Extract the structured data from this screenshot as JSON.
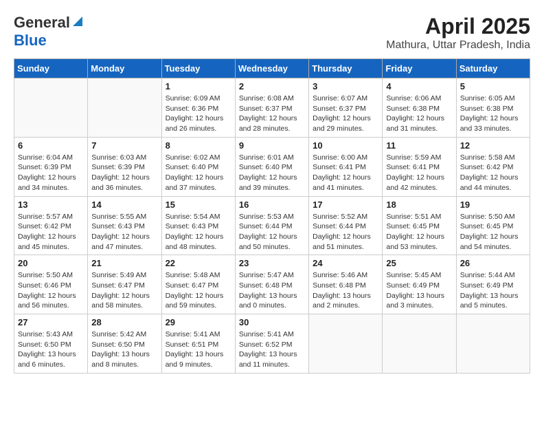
{
  "header": {
    "logo_general": "General",
    "logo_blue": "Blue",
    "month": "April 2025",
    "location": "Mathura, Uttar Pradesh, India"
  },
  "days_of_week": [
    "Sunday",
    "Monday",
    "Tuesday",
    "Wednesday",
    "Thursday",
    "Friday",
    "Saturday"
  ],
  "weeks": [
    [
      {
        "day": "",
        "info": ""
      },
      {
        "day": "",
        "info": ""
      },
      {
        "day": "1",
        "info": "Sunrise: 6:09 AM\nSunset: 6:36 PM\nDaylight: 12 hours and 26 minutes."
      },
      {
        "day": "2",
        "info": "Sunrise: 6:08 AM\nSunset: 6:37 PM\nDaylight: 12 hours and 28 minutes."
      },
      {
        "day": "3",
        "info": "Sunrise: 6:07 AM\nSunset: 6:37 PM\nDaylight: 12 hours and 29 minutes."
      },
      {
        "day": "4",
        "info": "Sunrise: 6:06 AM\nSunset: 6:38 PM\nDaylight: 12 hours and 31 minutes."
      },
      {
        "day": "5",
        "info": "Sunrise: 6:05 AM\nSunset: 6:38 PM\nDaylight: 12 hours and 33 minutes."
      }
    ],
    [
      {
        "day": "6",
        "info": "Sunrise: 6:04 AM\nSunset: 6:39 PM\nDaylight: 12 hours and 34 minutes."
      },
      {
        "day": "7",
        "info": "Sunrise: 6:03 AM\nSunset: 6:39 PM\nDaylight: 12 hours and 36 minutes."
      },
      {
        "day": "8",
        "info": "Sunrise: 6:02 AM\nSunset: 6:40 PM\nDaylight: 12 hours and 37 minutes."
      },
      {
        "day": "9",
        "info": "Sunrise: 6:01 AM\nSunset: 6:40 PM\nDaylight: 12 hours and 39 minutes."
      },
      {
        "day": "10",
        "info": "Sunrise: 6:00 AM\nSunset: 6:41 PM\nDaylight: 12 hours and 41 minutes."
      },
      {
        "day": "11",
        "info": "Sunrise: 5:59 AM\nSunset: 6:41 PM\nDaylight: 12 hours and 42 minutes."
      },
      {
        "day": "12",
        "info": "Sunrise: 5:58 AM\nSunset: 6:42 PM\nDaylight: 12 hours and 44 minutes."
      }
    ],
    [
      {
        "day": "13",
        "info": "Sunrise: 5:57 AM\nSunset: 6:42 PM\nDaylight: 12 hours and 45 minutes."
      },
      {
        "day": "14",
        "info": "Sunrise: 5:55 AM\nSunset: 6:43 PM\nDaylight: 12 hours and 47 minutes."
      },
      {
        "day": "15",
        "info": "Sunrise: 5:54 AM\nSunset: 6:43 PM\nDaylight: 12 hours and 48 minutes."
      },
      {
        "day": "16",
        "info": "Sunrise: 5:53 AM\nSunset: 6:44 PM\nDaylight: 12 hours and 50 minutes."
      },
      {
        "day": "17",
        "info": "Sunrise: 5:52 AM\nSunset: 6:44 PM\nDaylight: 12 hours and 51 minutes."
      },
      {
        "day": "18",
        "info": "Sunrise: 5:51 AM\nSunset: 6:45 PM\nDaylight: 12 hours and 53 minutes."
      },
      {
        "day": "19",
        "info": "Sunrise: 5:50 AM\nSunset: 6:45 PM\nDaylight: 12 hours and 54 minutes."
      }
    ],
    [
      {
        "day": "20",
        "info": "Sunrise: 5:50 AM\nSunset: 6:46 PM\nDaylight: 12 hours and 56 minutes."
      },
      {
        "day": "21",
        "info": "Sunrise: 5:49 AM\nSunset: 6:47 PM\nDaylight: 12 hours and 58 minutes."
      },
      {
        "day": "22",
        "info": "Sunrise: 5:48 AM\nSunset: 6:47 PM\nDaylight: 12 hours and 59 minutes."
      },
      {
        "day": "23",
        "info": "Sunrise: 5:47 AM\nSunset: 6:48 PM\nDaylight: 13 hours and 0 minutes."
      },
      {
        "day": "24",
        "info": "Sunrise: 5:46 AM\nSunset: 6:48 PM\nDaylight: 13 hours and 2 minutes."
      },
      {
        "day": "25",
        "info": "Sunrise: 5:45 AM\nSunset: 6:49 PM\nDaylight: 13 hours and 3 minutes."
      },
      {
        "day": "26",
        "info": "Sunrise: 5:44 AM\nSunset: 6:49 PM\nDaylight: 13 hours and 5 minutes."
      }
    ],
    [
      {
        "day": "27",
        "info": "Sunrise: 5:43 AM\nSunset: 6:50 PM\nDaylight: 13 hours and 6 minutes."
      },
      {
        "day": "28",
        "info": "Sunrise: 5:42 AM\nSunset: 6:50 PM\nDaylight: 13 hours and 8 minutes."
      },
      {
        "day": "29",
        "info": "Sunrise: 5:41 AM\nSunset: 6:51 PM\nDaylight: 13 hours and 9 minutes."
      },
      {
        "day": "30",
        "info": "Sunrise: 5:41 AM\nSunset: 6:52 PM\nDaylight: 13 hours and 11 minutes."
      },
      {
        "day": "",
        "info": ""
      },
      {
        "day": "",
        "info": ""
      },
      {
        "day": "",
        "info": ""
      }
    ]
  ]
}
